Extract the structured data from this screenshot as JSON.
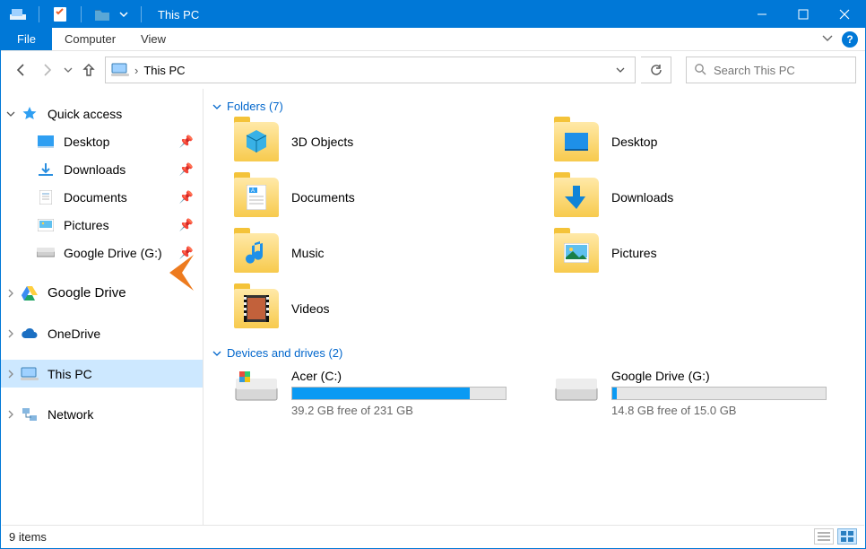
{
  "titlebar": {
    "title": "This PC"
  },
  "ribbon": {
    "file": "File",
    "tabs": [
      "Computer",
      "View"
    ]
  },
  "address": {
    "location": "This PC",
    "search_placeholder": "Search This PC"
  },
  "tree": {
    "quick_access": {
      "label": "Quick access",
      "children": [
        {
          "label": "Desktop"
        },
        {
          "label": "Downloads"
        },
        {
          "label": "Documents"
        },
        {
          "label": "Pictures"
        },
        {
          "label": "Google Drive (G:)"
        }
      ]
    },
    "google_drive": {
      "label": "Google Drive"
    },
    "onedrive": {
      "label": "OneDrive"
    },
    "this_pc": {
      "label": "This PC"
    },
    "network": {
      "label": "Network"
    }
  },
  "sections": {
    "folders": {
      "title": "Folders (7)"
    },
    "drives": {
      "title": "Devices and drives (2)"
    }
  },
  "folders": [
    {
      "name": "3D Objects"
    },
    {
      "name": "Desktop"
    },
    {
      "name": "Documents"
    },
    {
      "name": "Downloads"
    },
    {
      "name": "Music"
    },
    {
      "name": "Pictures"
    },
    {
      "name": "Videos"
    }
  ],
  "drives": [
    {
      "name": "Acer (C:)",
      "free_text": "39.2 GB free of 231 GB",
      "fill_pct": 83
    },
    {
      "name": "Google Drive (G:)",
      "free_text": "14.8 GB free of 15.0 GB",
      "fill_pct": 2
    }
  ],
  "statusbar": {
    "count": "9 items"
  }
}
